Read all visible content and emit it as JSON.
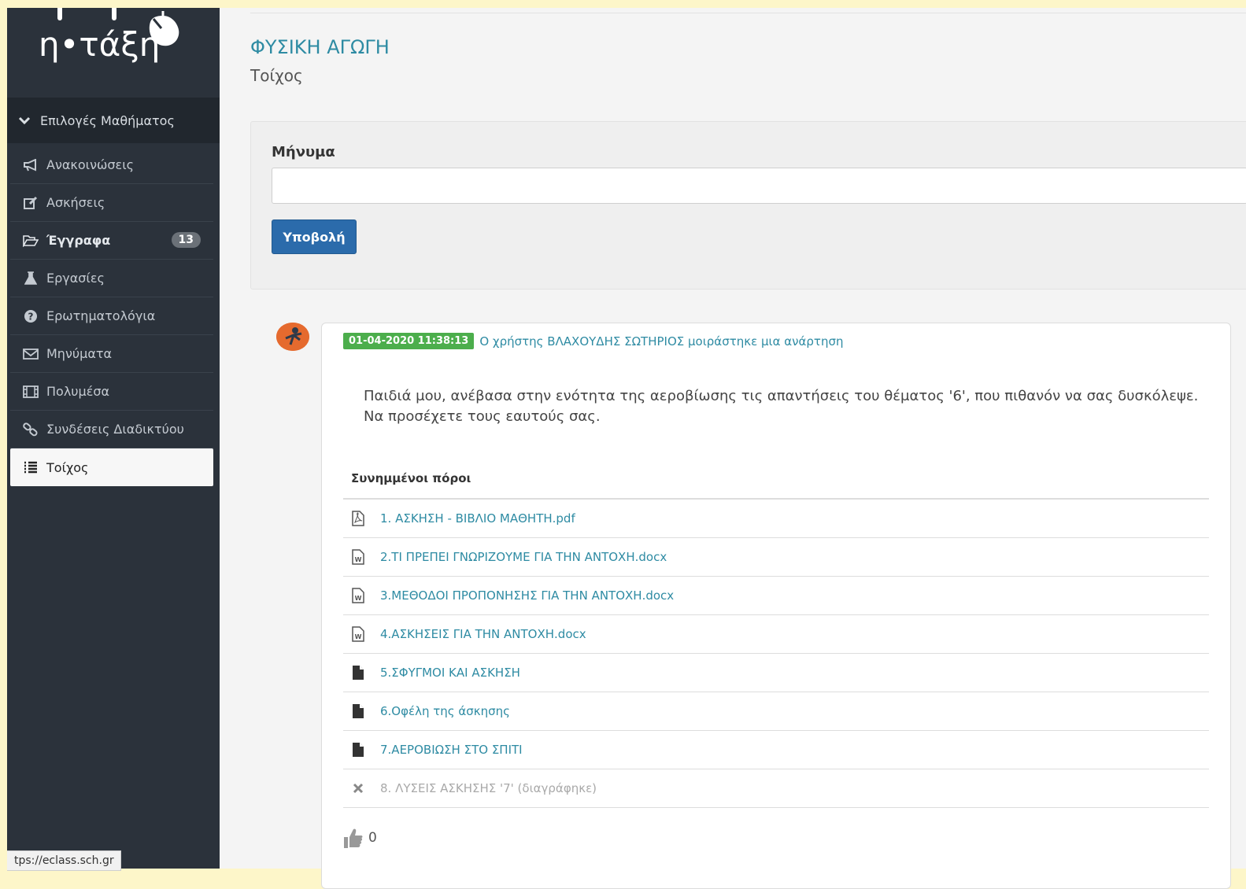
{
  "logo": {
    "text": "η•τάξη"
  },
  "sidebar": {
    "course_options_label": "Επιλογές Μαθήματος",
    "items": [
      {
        "label": "Ανακοινώσεις",
        "icon": "megaphone-icon"
      },
      {
        "label": "Ασκήσεις",
        "icon": "edit-icon"
      },
      {
        "label": "Έγγραφα",
        "icon": "folder-open-icon",
        "badge": "13"
      },
      {
        "label": "Εργασίες",
        "icon": "flask-icon"
      },
      {
        "label": "Ερωτηματολόγια",
        "icon": "question-circle-icon"
      },
      {
        "label": "Μηνύματα",
        "icon": "envelope-icon"
      },
      {
        "label": "Πολυμέσα",
        "icon": "film-icon"
      },
      {
        "label": "Συνδέσεις Διαδικτύου",
        "icon": "link-icon"
      },
      {
        "label": "Τοίχος",
        "icon": "list-icon",
        "active": true
      }
    ]
  },
  "statusbar": {
    "text": "tps://eclass.sch.gr"
  },
  "main": {
    "course_title": "ΦΥΣΙΚΗ ΑΓΩΓΗ",
    "page_subtitle": "Τοίχος",
    "form": {
      "label": "Μήνυμα",
      "message_value": "",
      "submit_label": "Υποβολή"
    }
  },
  "post": {
    "date": "01-04-2020 11:38:13",
    "meta_text": "Ο χρήστης ΒΛΑΧΟΥΔΗΣ ΣΩΤΗΡΙΟΣ μοιράστηκε μια ανάρτηση",
    "body": "Παιδιά μου, ανέβασα στην ενότητα της αεροβίωσης τις απαντήσεις του θέματος '6', που πιθανόν να σας δυσκόλεψε. Να προσέχετε τους εαυτούς σας.",
    "attachments_heading": "Συνημμένοι πόροι",
    "attachments": [
      {
        "name": "1. ΑΣΚΗΣΗ - ΒΙΒΛΙΟ ΜΑΘΗΤΗ.pdf",
        "icon": "file-pdf-icon"
      },
      {
        "name": "2.ΤΙ ΠΡΕΠΕΙ ΓΝΩΡΙΖΟΥΜΕ ΓΙΑ ΤΗΝ ΑΝΤΟΧΗ.docx",
        "icon": "file-word-icon"
      },
      {
        "name": "3.ΜΕΘΟΔΟΙ ΠΡΟΠΟΝΗΣΗΣ ΓΙΑ ΤΗΝ ΑΝΤΟΧΗ.docx",
        "icon": "file-word-icon"
      },
      {
        "name": "4.ΑΣΚΗΣΕΙΣ ΓΙΑ ΤΗΝ ΑΝΤΟΧΗ.docx",
        "icon": "file-word-icon"
      },
      {
        "name": "5.ΣΦΥΓΜΟΙ ΚΑΙ ΑΣΚΗΣΗ",
        "icon": "file-icon"
      },
      {
        "name": "6.Οφέλη της άσκησης",
        "icon": "file-icon"
      },
      {
        "name": "7.ΑΕΡΟΒΙΩΣΗ ΣΤΟ ΣΠΙΤΙ",
        "icon": "file-icon"
      },
      {
        "name": "8. ΛΥΣΕΙΣ ΑΣΚΗΣΗΣ '7' (διαγράφηκε)",
        "icon": "deleted-x-icon",
        "deleted": true
      }
    ],
    "likes": "0"
  },
  "colors": {
    "link": "#2e8ba3",
    "sidebar": "#2b323b",
    "button": "#2b6bab",
    "date_badge": "#4cae4c",
    "page_bg": "#fdf6c9"
  }
}
